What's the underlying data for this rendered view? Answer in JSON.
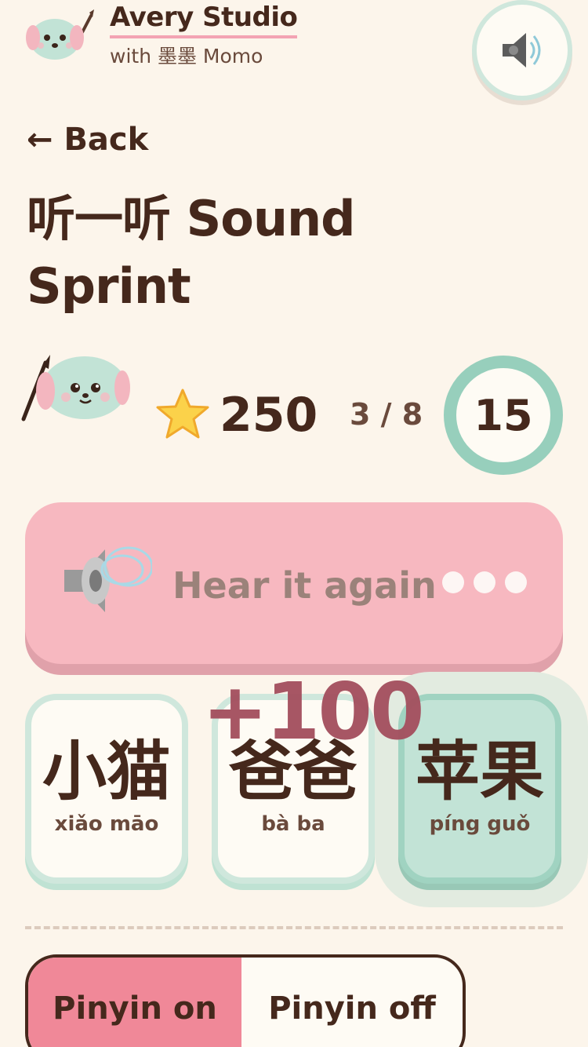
{
  "header": {
    "brand_title": "Avery Studio",
    "brand_subtitle": "with 墨墨 Momo",
    "logo_icon": "puppy-painter-icon",
    "sound_icon": "speaker-icon"
  },
  "nav": {
    "back_label": "← Back"
  },
  "page": {
    "title": "听一听 Sound Sprint"
  },
  "stats": {
    "mascot_icon": "puppy-mascot-icon",
    "star_icon": "star-icon",
    "score": "250",
    "progress": "3 / 8",
    "timer": "15"
  },
  "hear": {
    "label": "Hear it again",
    "icon": "speaker-icon"
  },
  "choices": [
    {
      "hanzi": "小猫",
      "pinyin": "xiǎo māo",
      "selected": false
    },
    {
      "hanzi": "爸爸",
      "pinyin": "bà ba",
      "selected": false
    },
    {
      "hanzi": "苹果",
      "pinyin": "píng guǒ",
      "selected": true
    }
  ],
  "feedback": {
    "points": "+100"
  },
  "pinyin_toggle": {
    "on_label": "Pinyin on",
    "off_label": "Pinyin off",
    "active": "on"
  },
  "colors": {
    "background": "#fcf5eb",
    "text": "#45281c",
    "pink": "#f7b8c0",
    "mint": "#c2e3d6",
    "accent_pink": "#f08898",
    "points": "#a4505f"
  }
}
